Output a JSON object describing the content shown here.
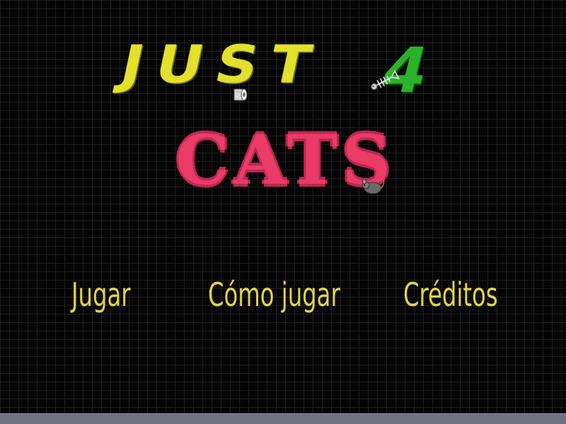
{
  "logo": {
    "top_text": "JUST",
    "four_text": "4",
    "bottom_text": "CATS"
  },
  "menu": {
    "items": [
      {
        "label": "Jugar"
      },
      {
        "label": "Cómo jugar"
      },
      {
        "label": "Créditos"
      }
    ]
  },
  "colors": {
    "logo_yellow": "#e2e02c",
    "logo_green": "#2ab32a",
    "logo_pink": "#df3f68",
    "menu_text": "#e3d34a",
    "background": "#050505",
    "bottom_bar": "#6f7080"
  },
  "icons": [
    "toilet-paper-icon",
    "fish-bone-icon",
    "mouse-icon"
  ]
}
